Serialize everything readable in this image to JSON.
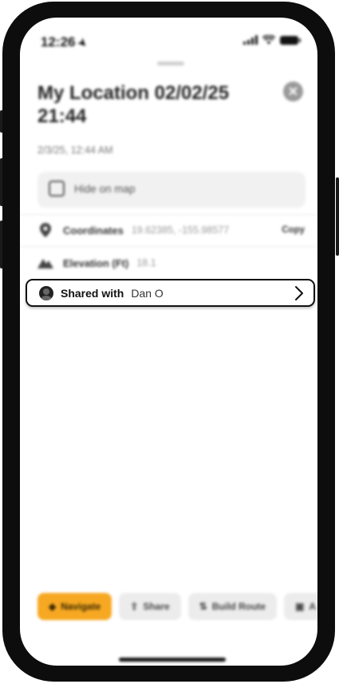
{
  "status_bar": {
    "time": "12:26"
  },
  "sheet": {
    "title": "My Location 02/02/25 21:44",
    "timestamp": "2/3/25, 12:44 AM",
    "hide_on_map_label": "Hide on map",
    "hide_on_map_checked": false
  },
  "details": {
    "coordinates_label": "Coordinates",
    "coordinates_value": "19.62385, -155.98577",
    "copy_label": "Copy",
    "elevation_label": "Elevation (Ft)",
    "elevation_value": "18.1"
  },
  "shared": {
    "label": "Shared with",
    "name": "Dan O"
  },
  "actions": [
    {
      "label": "Navigate",
      "icon": "navigate-icon"
    },
    {
      "label": "Share",
      "icon": "share-icon"
    },
    {
      "label": "Build Route",
      "icon": "route-icon"
    },
    {
      "label": "A",
      "icon": "layers-icon"
    }
  ],
  "colors": {
    "accent": "#f7a822",
    "card_border": "#111111",
    "secondary_button": "#ececec"
  }
}
